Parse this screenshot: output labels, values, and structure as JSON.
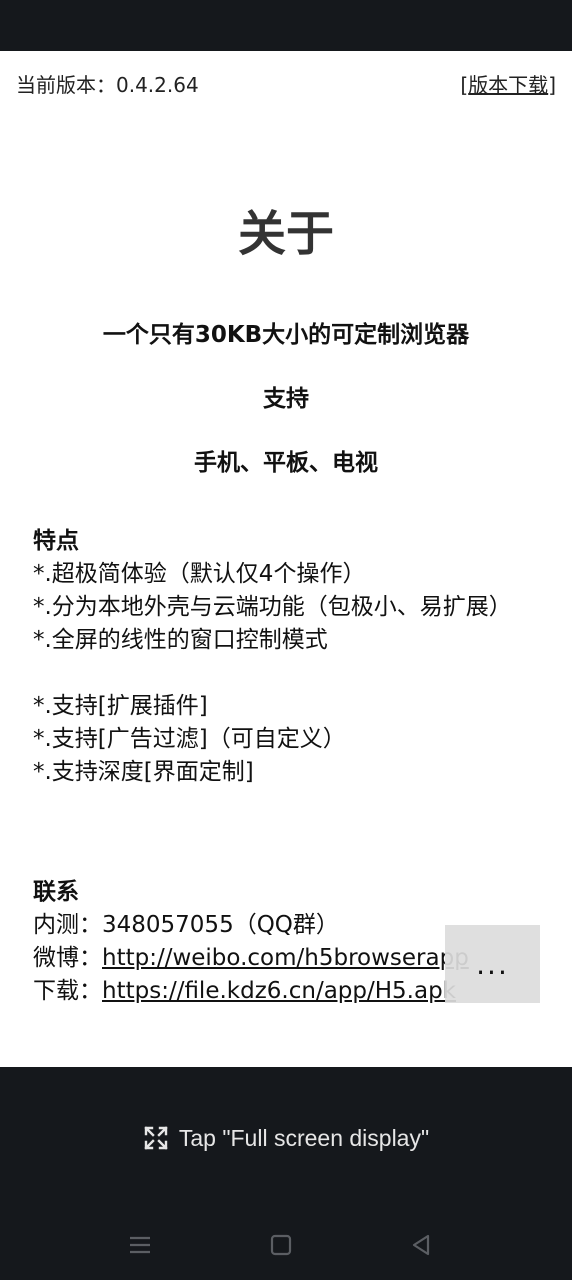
{
  "header": {
    "version_text": "当前版本：0.4.2.64",
    "download_label": "版本下载"
  },
  "about": {
    "title": "关于",
    "tagline": "一个只有30KB大小的可定制浏览器",
    "support_label": "支持",
    "platforms": "手机、平板、电视"
  },
  "features": {
    "heading": "特点",
    "items": [
      "*.超极简体验（默认仅4个操作）",
      "*.分为本地外壳与云端功能（包极小、易扩展）",
      "*.全屏的线性的窗口控制模式",
      "*.支持[扩展插件]",
      "*.支持[广告过滤]（可自定义）",
      "*.支持深度[界面定制]"
    ]
  },
  "contact": {
    "heading": "联系",
    "qq_label": "内测：",
    "qq_value": "348057055（QQ群）",
    "weibo_label": "微博：",
    "weibo_url": "http://weibo.com/h5browserapp",
    "download_label": "下载：",
    "download_url": "https://file.kdz6.cn/app/H5.apk"
  },
  "overlay": {
    "more_label": "..."
  },
  "fullscreen_hint": "Tap \"Full screen display\"",
  "icons": {
    "fullscreen": "expand-arrows-icon",
    "menu": "menu-icon",
    "home": "home-square-icon",
    "back": "back-triangle-icon"
  },
  "colors": {
    "system_bar": "#15181c",
    "page_bg": "#ffffff",
    "overlay_button": "#dcdcdc"
  }
}
